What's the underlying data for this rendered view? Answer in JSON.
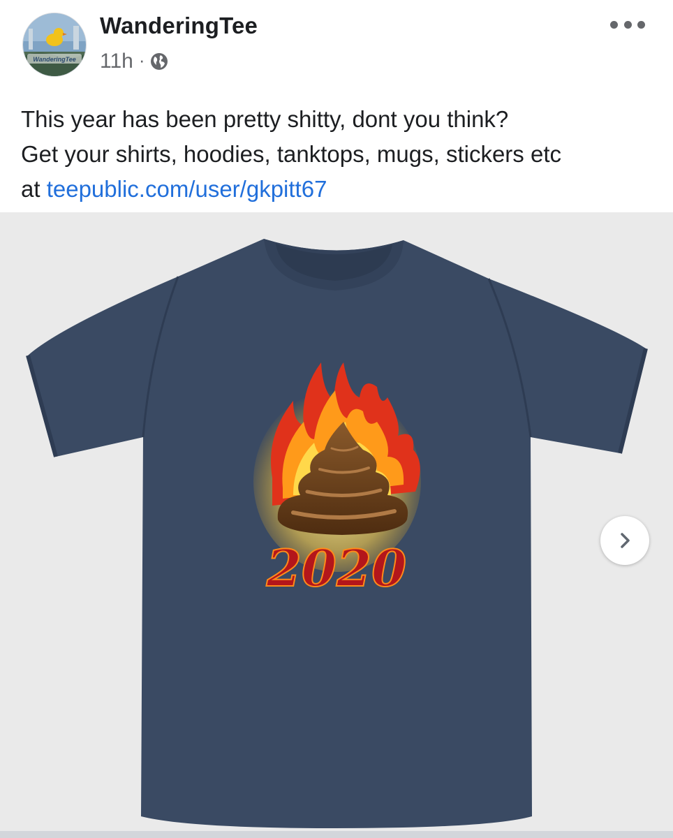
{
  "post": {
    "author": {
      "name": "WanderingTee",
      "avatar_caption": "WanderingTee"
    },
    "meta": {
      "time": "11h",
      "separator": "·",
      "audience_icon": "globe-icon"
    },
    "more_icon": "more-horizontal-icon",
    "text": {
      "line1": "This year has been pretty shitty, dont you think?",
      "line2": "Get your shirts, hoodies, tanktops, mugs, stickers etc",
      "line3_prefix": "at ",
      "link": "teepublic.com/user/gkpitt67"
    },
    "media": {
      "shirt_color": "#3a4a63",
      "background_color": "#eaeaea",
      "print_text": "2020",
      "print_text_color": "#b3161b",
      "next_icon": "chevron-right-icon"
    }
  },
  "colors": {
    "text": "#1c1e21",
    "secondary": "#65676b",
    "link": "#216fdb"
  }
}
